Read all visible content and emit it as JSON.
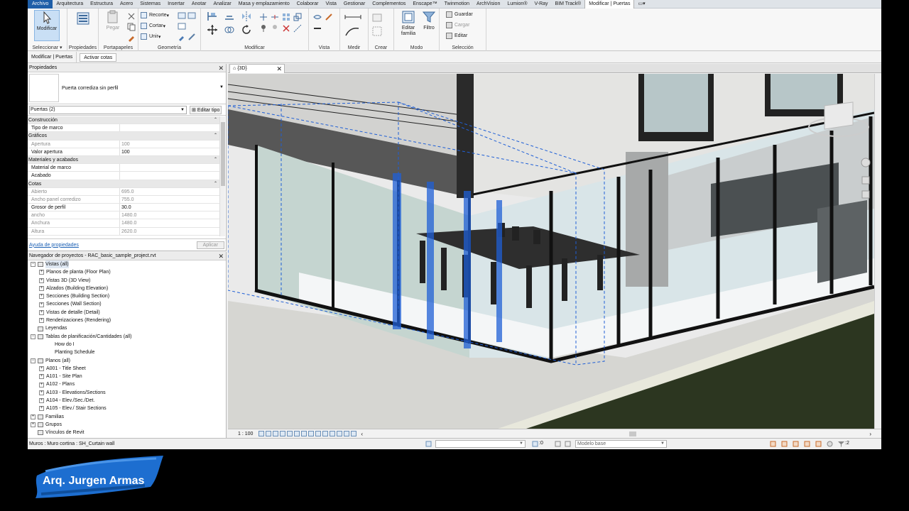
{
  "menu": {
    "items": [
      "Archivo",
      "Arquitectura",
      "Estructura",
      "Acero",
      "Sistemas",
      "Insertar",
      "Anotar",
      "Analizar",
      "Masa y emplazamiento",
      "Colaborar",
      "Vista",
      "Gestionar",
      "Complementos",
      "Enscape™",
      "Twinmotion",
      "ArchVision",
      "Lumion®",
      "V-Ray",
      "BIM Track®",
      "Modificar | Puertas"
    ]
  },
  "ribbon": {
    "modify_label": "Modificar",
    "paste_label": "Pegar",
    "recorte_label": "Recorte",
    "cortar_label": "Cortar",
    "unir_label": "Unir",
    "editar_familia_label": "Editar familia",
    "filtro_label": "Filtro",
    "guardar_label": "Guardar",
    "cargar_label": "Cargar",
    "editar_label": "Editar",
    "groups": {
      "seleccionar": "Seleccionar",
      "propiedades": "Propiedades",
      "portapapeles": "Portapapeles",
      "geometria": "Geometría",
      "modificar": "Modificar",
      "vista": "Vista",
      "medir": "Medir",
      "crear": "Crear",
      "modo": "Modo",
      "seleccion": "Selección"
    }
  },
  "context_bar": {
    "label": "Modificar | Puertas",
    "activar_cotas": "Activar cotas"
  },
  "properties": {
    "title": "Propiedades",
    "type_name": "Puerta corrediza sin perfil",
    "instance_filter": "Puertas (2)",
    "edit_type": "Editar tipo",
    "rows": [
      {
        "k": "Construcción",
        "cat": true
      },
      {
        "k": "Tipo de marco",
        "v": ""
      },
      {
        "k": "Gráficos",
        "cat": true
      },
      {
        "k": "Apertura",
        "v": "100",
        "dim": true
      },
      {
        "k": "Valor apertura",
        "v": "100"
      },
      {
        "k": "Materiales y acabados",
        "cat": true
      },
      {
        "k": "Material de marco",
        "v": ""
      },
      {
        "k": "Acabado",
        "v": ""
      },
      {
        "k": "Cotas",
        "cat": true
      },
      {
        "k": "Abierto",
        "v": "695.0",
        "dim": true
      },
      {
        "k": "Ancho panel corredizo",
        "v": "755.0",
        "dim": true
      },
      {
        "k": "Grosor de perfil",
        "v": "30.0"
      },
      {
        "k": "ancho",
        "v": "1480.0",
        "dim": true
      },
      {
        "k": "Anchura",
        "v": "1480.0",
        "dim": true
      },
      {
        "k": "Altura",
        "v": "2620.0",
        "dim": true
      }
    ],
    "help_link": "Ayuda de propiedades",
    "apply": "Aplicar"
  },
  "browser": {
    "title": "Navegador de proyectos - RAC_basic_sample_project.rvt",
    "items": [
      {
        "label": "Vistas (all)",
        "level": 0,
        "exp": "−",
        "icon": true,
        "hl": true
      },
      {
        "label": "Planos de planta (Floor Plan)",
        "level": 1,
        "exp": "+"
      },
      {
        "label": "Vistas 3D (3D View)",
        "level": 1,
        "exp": "+"
      },
      {
        "label": "Alzados (Building Elevation)",
        "level": 1,
        "exp": "+"
      },
      {
        "label": "Secciones (Building Section)",
        "level": 1,
        "exp": "+"
      },
      {
        "label": "Secciones (Wall Section)",
        "level": 1,
        "exp": "+"
      },
      {
        "label": "Vistas de detalle (Detail)",
        "level": 1,
        "exp": "+"
      },
      {
        "label": "Renderizaciones (Rendering)",
        "level": 1,
        "exp": "+"
      },
      {
        "label": "Leyendas",
        "level": 0,
        "exp": "",
        "icon": true
      },
      {
        "label": "Tablas de planificación/Cantidades (all)",
        "level": 0,
        "exp": "−",
        "icon": true
      },
      {
        "label": "How do I",
        "level": 2,
        "exp": ""
      },
      {
        "label": "Planting Schedule",
        "level": 2,
        "exp": ""
      },
      {
        "label": "Planos (all)",
        "level": 0,
        "exp": "−",
        "icon": true
      },
      {
        "label": "A001 - Title Sheet",
        "level": 1,
        "exp": "+"
      },
      {
        "label": "A101 - Site Plan",
        "level": 1,
        "exp": "+"
      },
      {
        "label": "A102 - Plans",
        "level": 1,
        "exp": "+"
      },
      {
        "label": "A103 - Elevations/Sections",
        "level": 1,
        "exp": "+"
      },
      {
        "label": "A104 - Elev./Sec./Det.",
        "level": 1,
        "exp": "+"
      },
      {
        "label": "A105 - Elev./ Stair Sections",
        "level": 1,
        "exp": "+"
      },
      {
        "label": "Familias",
        "level": 0,
        "exp": "+",
        "icon": true
      },
      {
        "label": "Grupos",
        "level": 0,
        "exp": "+",
        "icon": true
      },
      {
        "label": "Vínculos de Revit",
        "level": 0,
        "exp": "",
        "icon": true
      }
    ]
  },
  "view": {
    "tab": "{3D}",
    "scale": "1 : 100"
  },
  "status": {
    "text": "Muros : Muro cortina : SH_Curtain wall",
    "counter": ":0",
    "model": "Modelo base",
    "filter_count": ":2"
  },
  "brand": {
    "name": "Arq. Jurgen Armas"
  },
  "colors": {
    "selection_blue": "#1f5fd6",
    "file_tab": "#1f5fa8",
    "brand_stroke": "#1d6ed0"
  }
}
